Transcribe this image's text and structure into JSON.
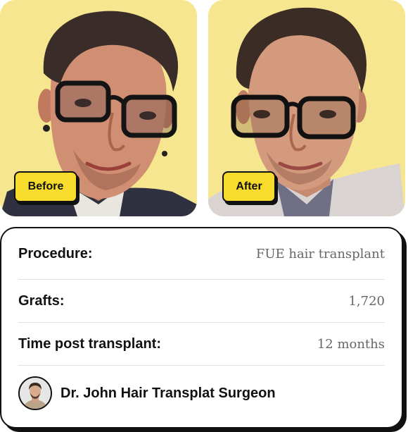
{
  "photos": {
    "before_label": "Before",
    "after_label": "After",
    "background_color": "#f6e68f",
    "tag_color": "#f7dc2e"
  },
  "details": [
    {
      "label": "Procedure:",
      "value": "FUE hair transplant"
    },
    {
      "label": "Grafts:",
      "value": "1,720"
    },
    {
      "label": "Time post transplant:",
      "value": "12 months"
    }
  ],
  "surgeon": {
    "name": "Dr. John Hair Transplat Surgeon"
  }
}
